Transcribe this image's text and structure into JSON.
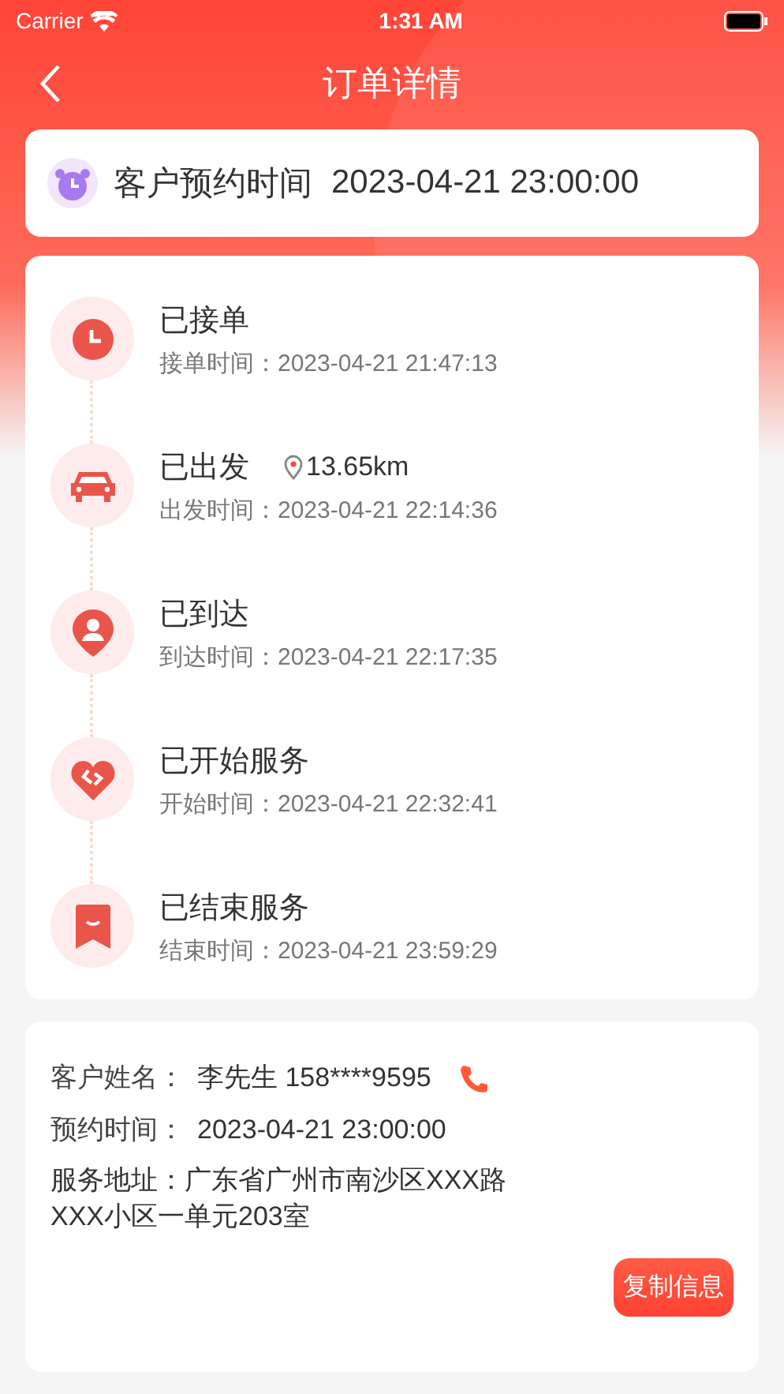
{
  "status_bar": {
    "carrier": "Carrier",
    "time": "1:31 AM"
  },
  "nav": {
    "title": "订单详情"
  },
  "appointment": {
    "label": "客户预约时间",
    "time": "2023-04-21 23:00:00"
  },
  "timeline": [
    {
      "kind": "clock",
      "title": "已接单",
      "subtitle": "接单时间：2023-04-21 21:47:13"
    },
    {
      "kind": "car",
      "title": "已出发",
      "distance": "13.65km",
      "subtitle": "出发时间：2023-04-21 22:14:36"
    },
    {
      "kind": "pin",
      "title": "已到达",
      "subtitle": "到达时间：2023-04-21 22:17:35"
    },
    {
      "kind": "heart",
      "title": "已开始服务",
      "subtitle": "开始时间：2023-04-21 22:32:41"
    },
    {
      "kind": "ribbon",
      "title": "已结束服务",
      "subtitle": "结束时间：2023-04-21 23:59:29"
    }
  ],
  "customer": {
    "name_label": "客户姓名：",
    "name": "李先生 158****9595",
    "time_label": "预约时间：",
    "time": "2023-04-21 23:00:00",
    "address": "服务地址：广东省广州市南沙区XXX路XXX小区一单元203室",
    "copy_button": "复制信息"
  }
}
